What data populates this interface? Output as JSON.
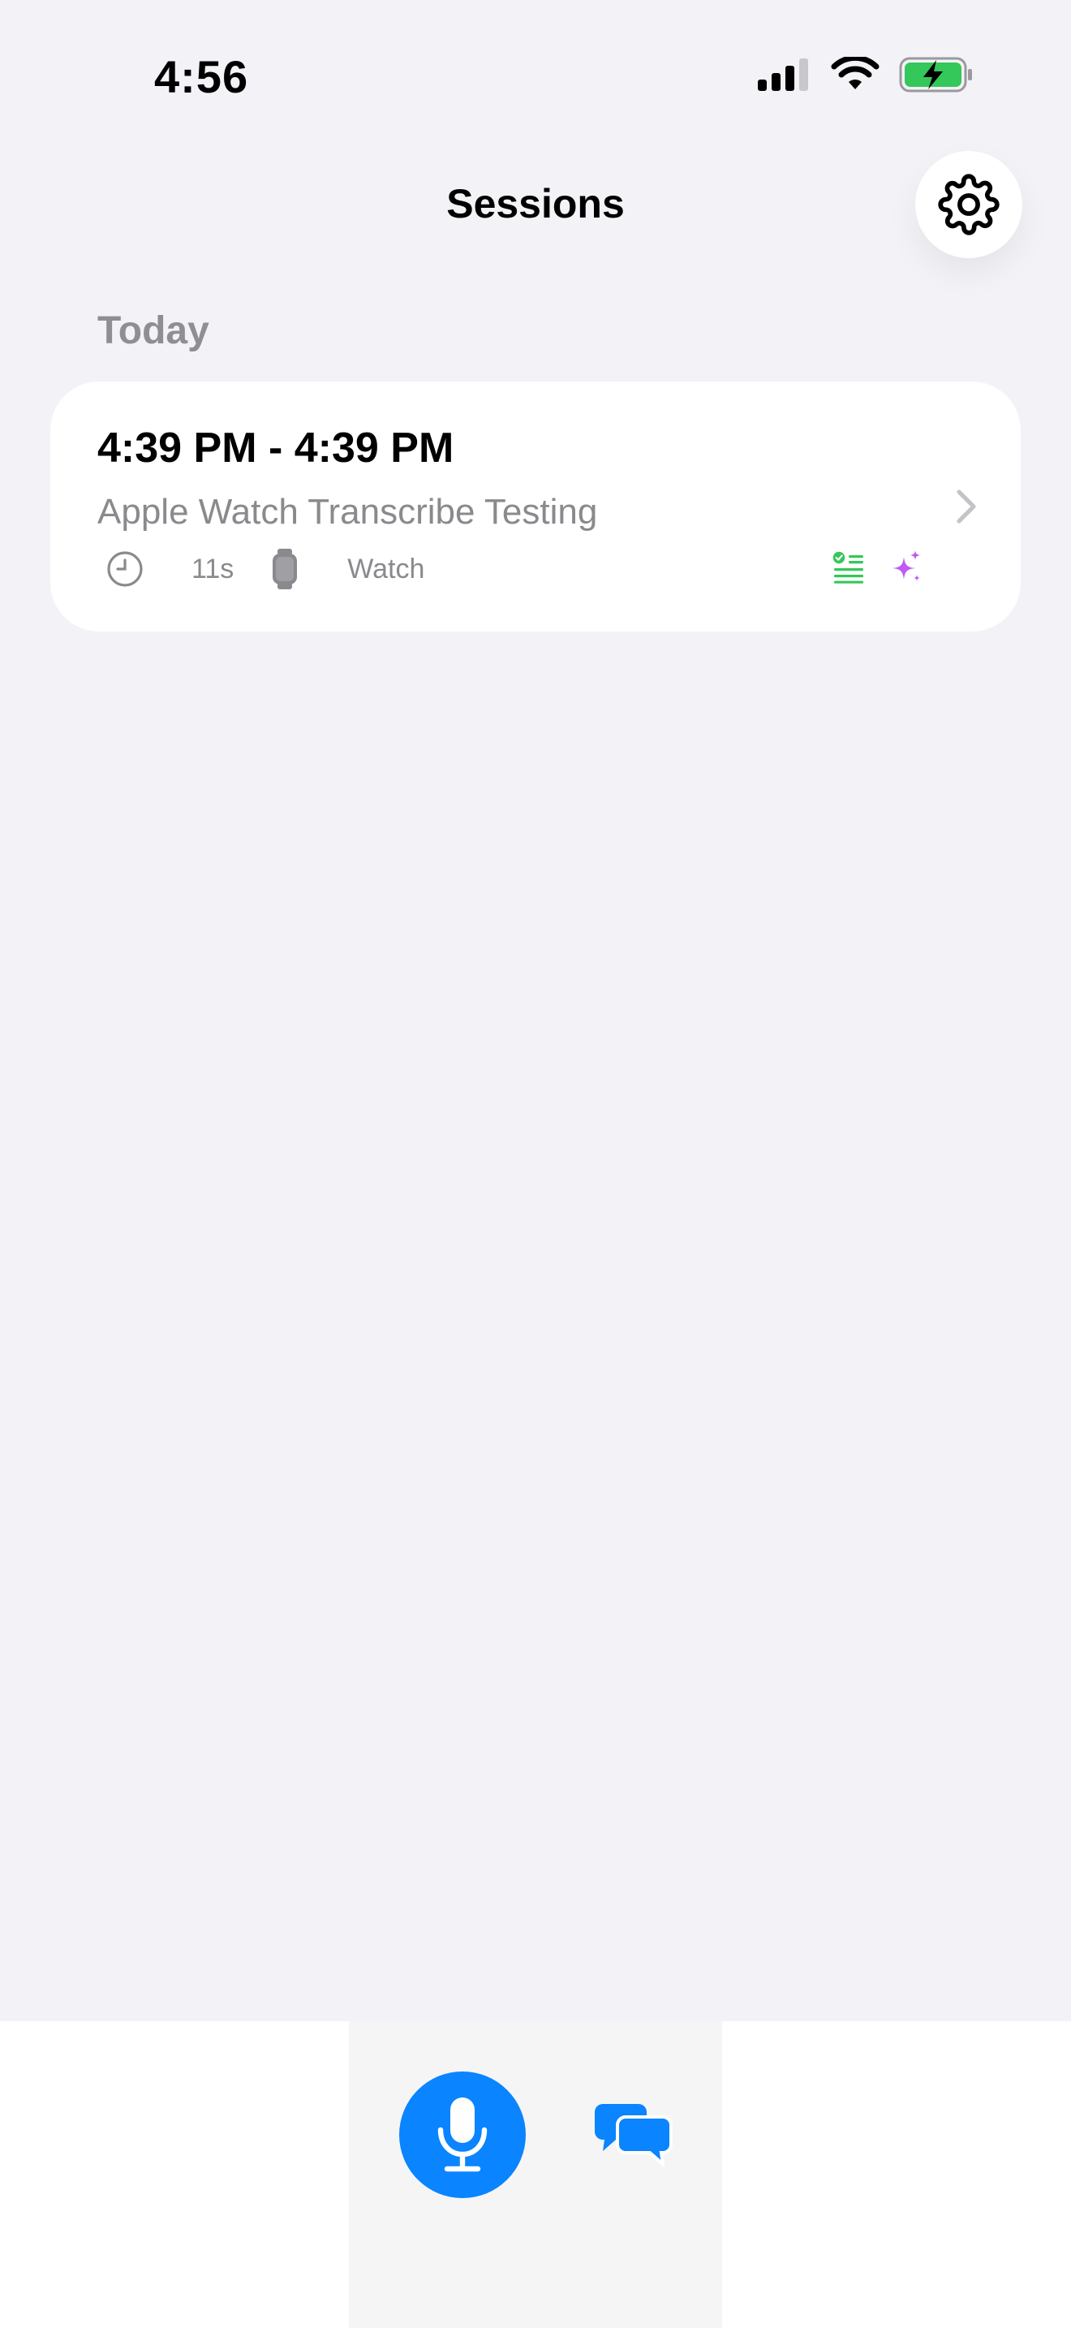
{
  "status_bar": {
    "time": "4:56"
  },
  "nav": {
    "title": "Sessions"
  },
  "sections": [
    {
      "header": "Today",
      "sessions": [
        {
          "time_range": "4:39 PM - 4:39 PM",
          "title": "Apple Watch Transcribe Testing",
          "duration": "11s",
          "source": "Watch"
        }
      ]
    }
  ],
  "icons": {
    "settings": "gear-icon",
    "clock": "clock-icon",
    "watch": "watch-icon",
    "checklist": "checklist-icon",
    "sparkles": "sparkles-icon",
    "chevron": "chevron-right-icon",
    "mic": "microphone-icon",
    "chat": "chat-bubbles-icon"
  },
  "colors": {
    "background": "#F2F2F7",
    "accent_blue": "#0A84FF",
    "checklist_green": "#34C759",
    "sparkles_purple": "#BF5AF2",
    "secondary_text": "#8A8A8E",
    "battery_green": "#34C759"
  }
}
